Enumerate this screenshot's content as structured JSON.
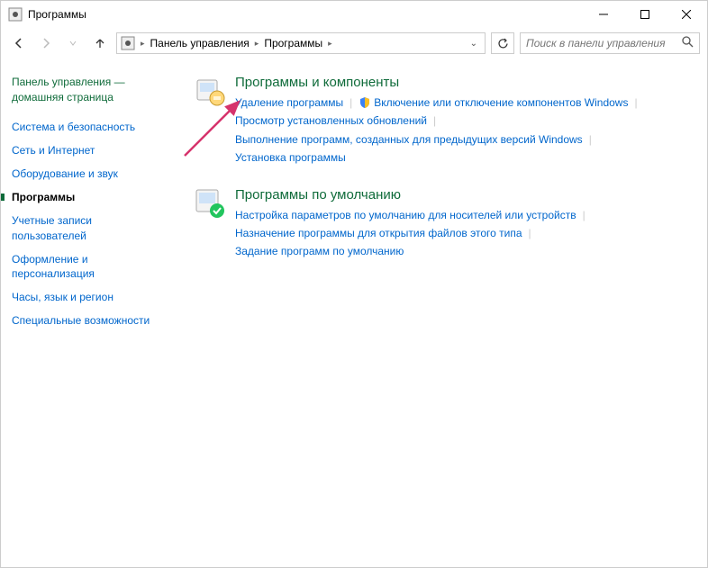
{
  "window": {
    "title": "Программы"
  },
  "breadcrumb": {
    "root": "Панель управления",
    "current": "Программы"
  },
  "search": {
    "placeholder": "Поиск в панели управления"
  },
  "sidebar": {
    "header": "Панель управления — домашняя страница",
    "items": [
      {
        "label": "Система и безопасность"
      },
      {
        "label": "Сеть и Интернет"
      },
      {
        "label": "Оборудование и звук"
      },
      {
        "label": "Программы"
      },
      {
        "label": "Учетные записи пользователей"
      },
      {
        "label": "Оформление и персонализация"
      },
      {
        "label": "Часы, язык и регион"
      },
      {
        "label": "Специальные возможности"
      }
    ],
    "active_index": 3
  },
  "sections": [
    {
      "title": "Программы и компоненты",
      "links": [
        {
          "label": "Удаление программы",
          "shield": false
        },
        {
          "label": "Включение или отключение компонентов Windows",
          "shield": true
        },
        {
          "label": "Просмотр установленных обновлений",
          "shield": false
        },
        {
          "label": "Выполнение программ, созданных для предыдущих версий Windows",
          "shield": false
        },
        {
          "label": "Установка программы",
          "shield": false
        }
      ]
    },
    {
      "title": "Программы по умолчанию",
      "links": [
        {
          "label": "Настройка параметров по умолчанию для носителей или устройств",
          "shield": false
        },
        {
          "label": "Назначение программы для открытия файлов этого типа",
          "shield": false
        },
        {
          "label": "Задание программ по умолчанию",
          "shield": false
        }
      ]
    }
  ]
}
